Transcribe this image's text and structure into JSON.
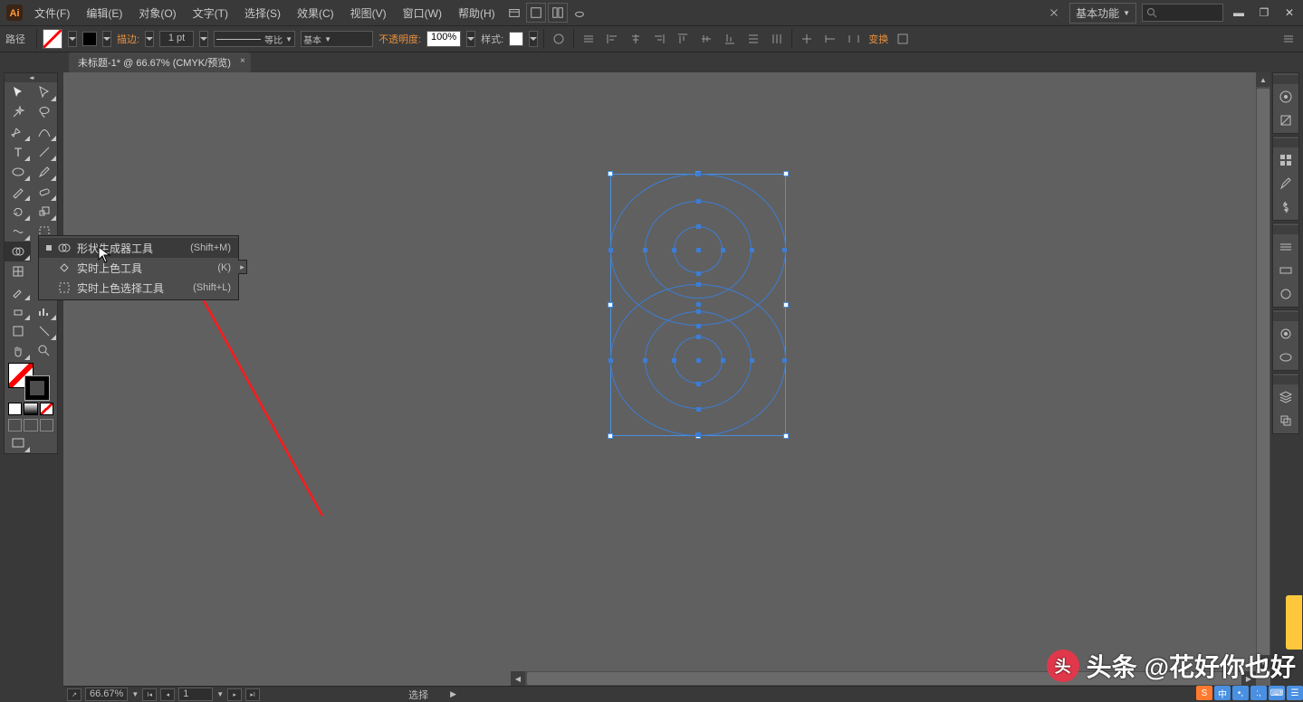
{
  "menubar": {
    "items": [
      "文件(F)",
      "编辑(E)",
      "对象(O)",
      "文字(T)",
      "选择(S)",
      "效果(C)",
      "视图(V)",
      "窗口(W)",
      "帮助(H)"
    ],
    "workspace": "基本功能"
  },
  "controlbar": {
    "mode": "路径",
    "stroke_label": "描边:",
    "stroke_weight": "1 pt",
    "profile_label": "等比",
    "brush_label": "基本",
    "opacity_label": "不透明度:",
    "opacity_value": "100%",
    "style_label": "样式:",
    "transform_label": "变换"
  },
  "tab": {
    "title": "未标题-1* @ 66.67% (CMYK/预览)"
  },
  "flyout": {
    "items": [
      {
        "label": "形状生成器工具",
        "shortcut": "(Shift+M)",
        "selected": true
      },
      {
        "label": "实时上色工具",
        "shortcut": "(K)",
        "selected": false
      },
      {
        "label": "实时上色选择工具",
        "shortcut": "(Shift+L)",
        "selected": false
      }
    ]
  },
  "statusbar": {
    "zoom": "66.67%",
    "artboard": "1",
    "tool": "选择"
  },
  "watermark": {
    "source": "头条",
    "author": "@花好你也好"
  }
}
